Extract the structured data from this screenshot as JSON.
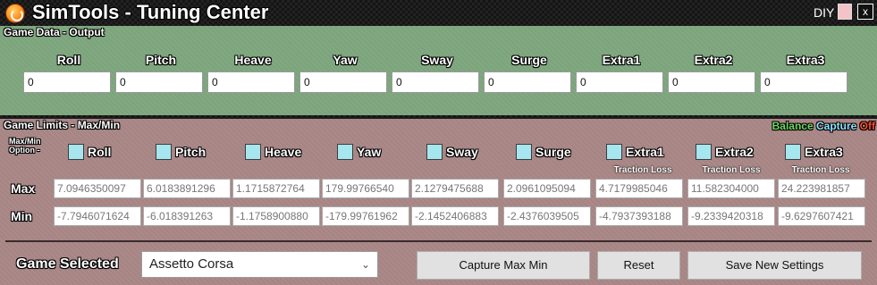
{
  "titlebar": {
    "title_bold1": "Sim",
    "title_part2": "Tools - ",
    "title_bold3": "Tuning",
    "title_part4": " Center",
    "diy_label": "DIY",
    "close_label": "x",
    "icon": "simtools-logo-icon"
  },
  "output": {
    "title": "Game Data - Output",
    "columns": [
      {
        "label": "Roll",
        "value": "0"
      },
      {
        "label": "Pitch",
        "value": "0"
      },
      {
        "label": "Heave",
        "value": "0"
      },
      {
        "label": "Yaw",
        "value": "0"
      },
      {
        "label": "Sway",
        "value": "0"
      },
      {
        "label": "Surge",
        "value": "0"
      },
      {
        "label": "Extra1",
        "value": "0"
      },
      {
        "label": "Extra2",
        "value": "0"
      },
      {
        "label": "Extra3",
        "value": "0"
      }
    ]
  },
  "limits": {
    "title": "Game Limits - Max/Min",
    "balance": "Balance",
    "capture": "Capture",
    "off": "Off",
    "maxmin_option_line1": "Max/Min",
    "maxmin_option_line2": "Option -",
    "options": [
      "Roll",
      "Pitch",
      "Heave",
      "Yaw",
      "Sway",
      "Surge",
      "Extra1",
      "Extra2",
      "Extra3"
    ],
    "extra_note": "Traction Loss",
    "max_label": "Max",
    "min_label": "Min",
    "max_values": [
      "7.0946350097",
      "6.0183891296",
      "1.1715872764",
      "179.99766540",
      "2.1279475688",
      "2.0961095094",
      "4.7179985046",
      "11.582304000",
      "24.223981857"
    ],
    "min_values": [
      "-7.7946071624",
      "-6.018391263",
      "-1.1758900880",
      "-179.99761962",
      "-2.1452406883",
      "-2.4376039505",
      "-4.7937393188",
      "-9.2339420318",
      "-9.6297607421"
    ]
  },
  "game": {
    "label": "Game Selected",
    "selected": "Assetto Corsa"
  },
  "buttons": {
    "capture": "Capture Max Min",
    "reset": "Reset",
    "save": "Save New Settings"
  },
  "colors": {
    "output_bg": "#7ba47b",
    "limits_bg": "#a78484",
    "checkbox": "#a6e6ee",
    "balance": "#6cd860",
    "capture": "#8fe3ff",
    "off": "#ff4b2b"
  }
}
